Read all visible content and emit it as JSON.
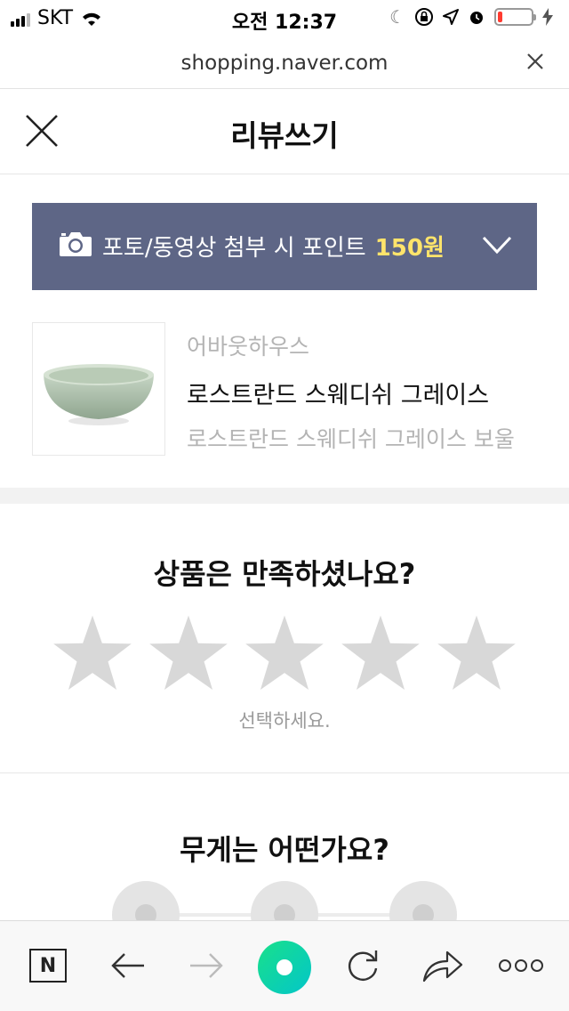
{
  "status_bar": {
    "carrier": "SKT",
    "time": "오전 12:37",
    "battery_level": 0.15,
    "battery_color": "#ff3b30"
  },
  "url_bar": {
    "url": "shopping.naver.com",
    "close_icon": "close-icon"
  },
  "header": {
    "title": "리뷰쓰기",
    "close_icon": "close-icon"
  },
  "banner": {
    "text": "포토/동영상 첨부 시 포인트",
    "points": "150원",
    "bg_color": "#5e6686",
    "points_color": "#ffe46b",
    "icons": [
      "camera-icon",
      "chevron-down-icon"
    ]
  },
  "product": {
    "brand": "어바웃하우스",
    "name": "로스트란드 스웨디쉬 그레이스",
    "option": "로스트란드 스웨디쉬 그레이스 보울"
  },
  "rating": {
    "question": "상품은 만족하셨나요?",
    "max_stars": 5,
    "selected": 0,
    "hint": "선택하세요.",
    "star_color": "#d8d8d8"
  },
  "weight": {
    "question": "무게는 어떤가요?",
    "option_count": 3
  },
  "toolbar": {
    "items": [
      "naver-home-icon",
      "back-arrow-icon",
      "forward-arrow-icon",
      "green-dot-icon",
      "reload-icon",
      "share-icon",
      "more-icon"
    ],
    "accent": "#19e08a"
  }
}
